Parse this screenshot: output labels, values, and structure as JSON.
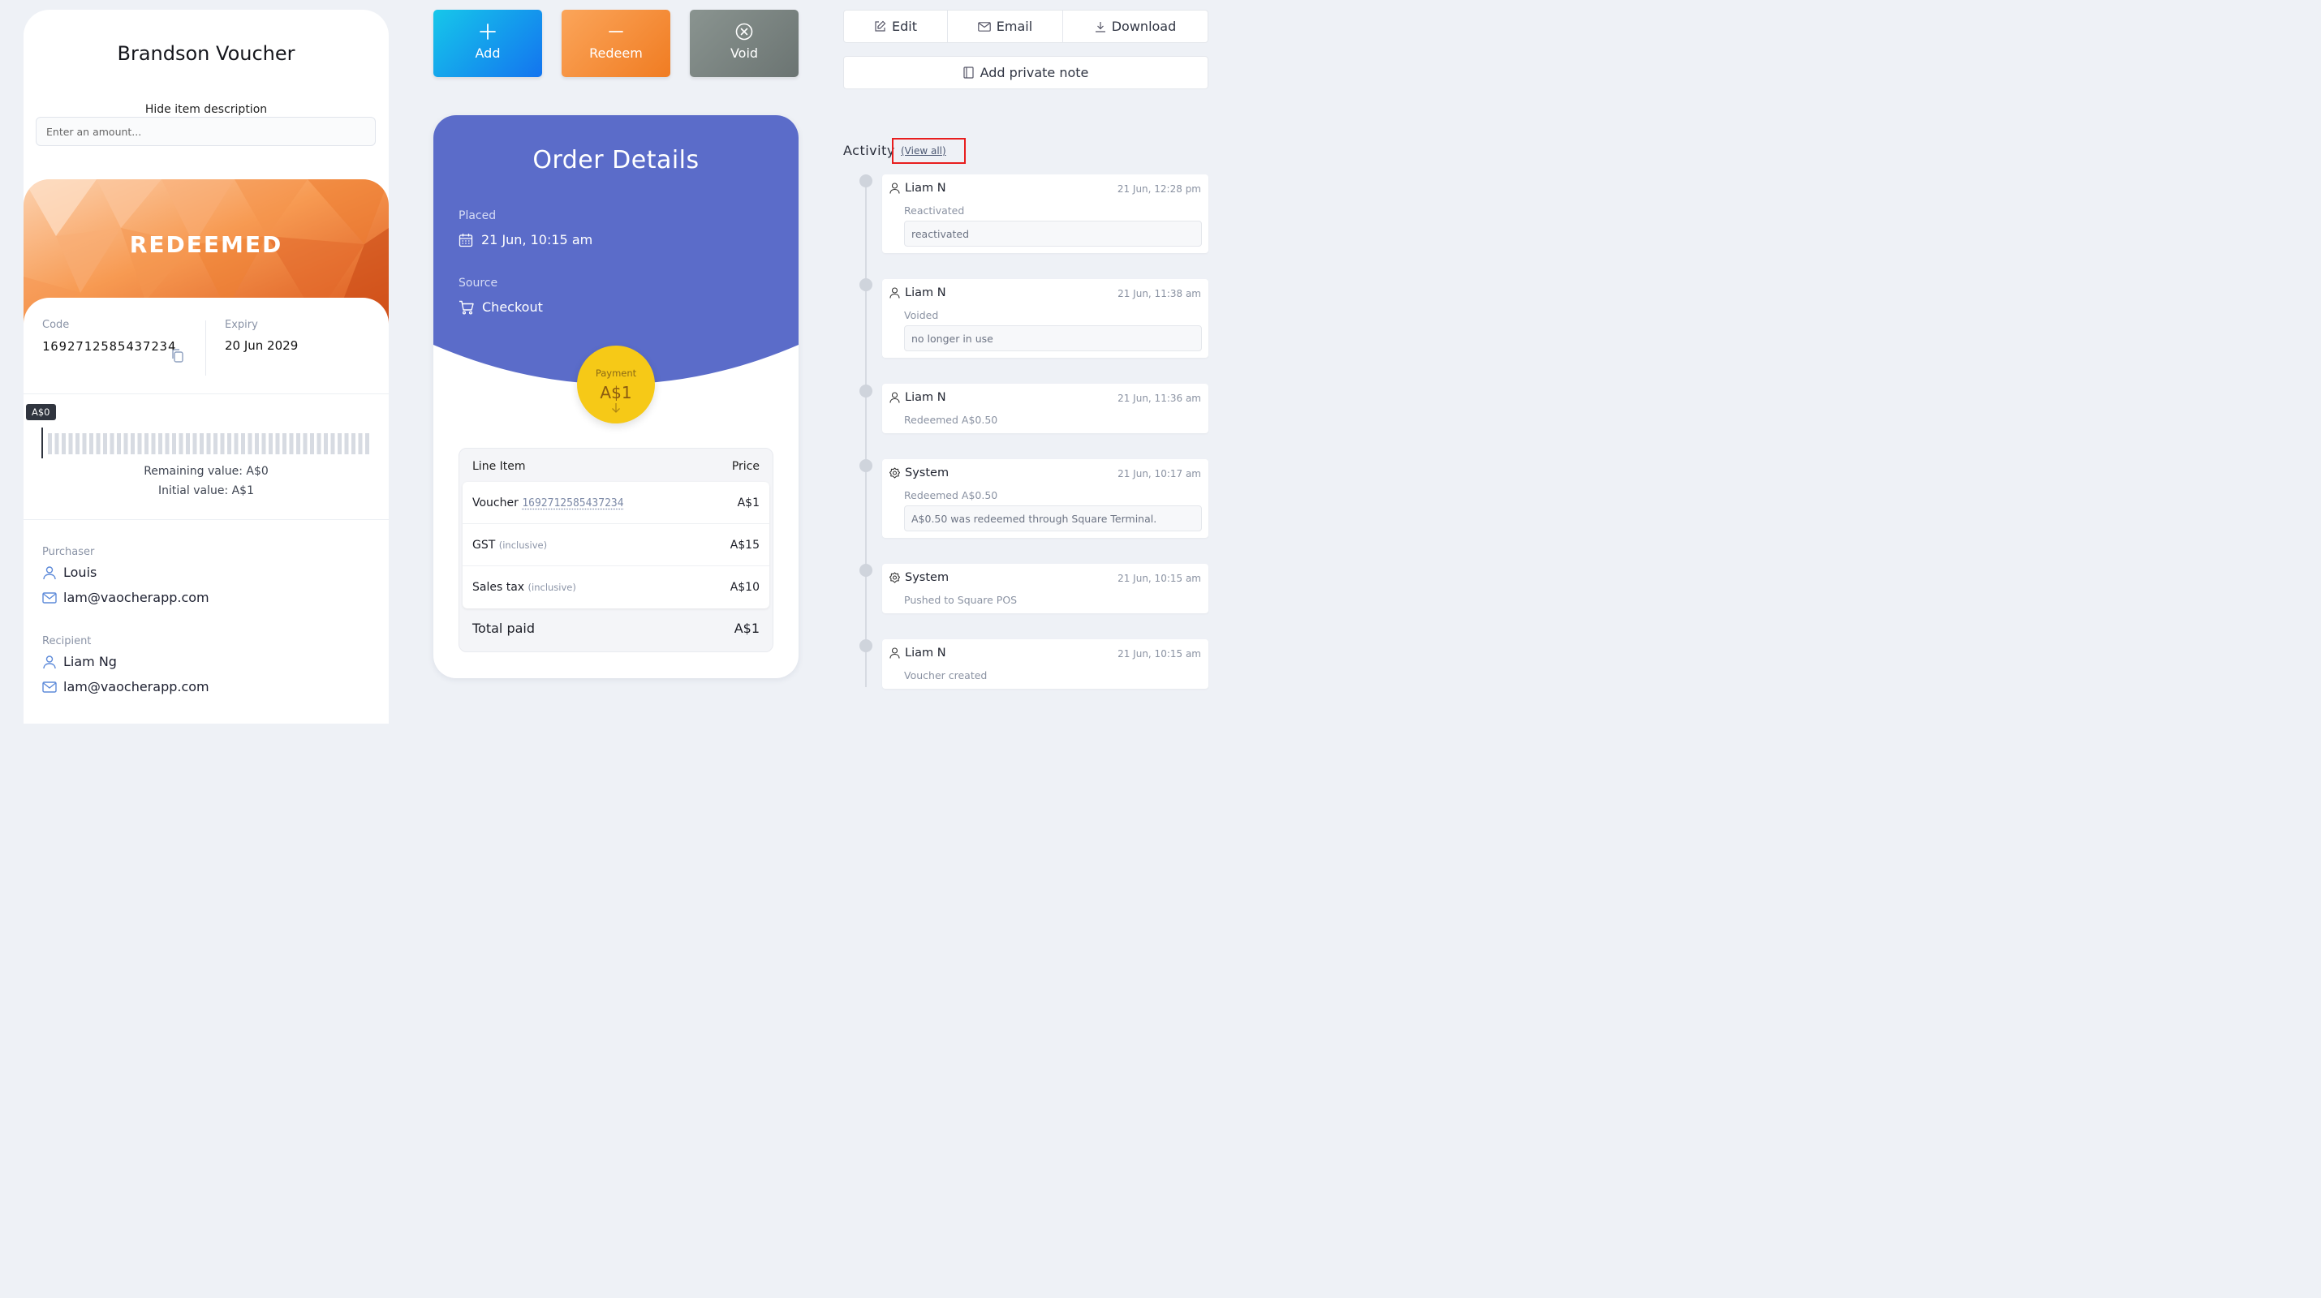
{
  "voucher": {
    "title": "Brandson Voucher",
    "hide_description": "Hide item description",
    "amount_placeholder": "Enter an amount...",
    "status": "REDEEMED",
    "code_label": "Code",
    "code": "1692712585437234",
    "expiry_label": "Expiry",
    "expiry": "20 Jun 2029",
    "balance_tag": "A$0",
    "balance_fraction": 0,
    "remaining": "Remaining value: A$0",
    "initial": "Initial value: A$1",
    "purchaser_label": "Purchaser",
    "purchaser_name": "Louis",
    "purchaser_email": "lam@vaocherapp.com",
    "recipient_label": "Recipient",
    "recipient_name": "Liam Ng",
    "recipient_email": "lam@vaocherapp.com"
  },
  "actions": {
    "add": "Add",
    "redeem": "Redeem",
    "void": "Void"
  },
  "order": {
    "title": "Order Details",
    "placed_label": "Placed",
    "placed_value": "21 Jun, 10:15 am",
    "source_label": "Source",
    "source_value": "Checkout",
    "payment_label": "Payment",
    "payment_value": "A$1",
    "col_item": "Line Item",
    "col_price": "Price",
    "items": [
      {
        "name": "Voucher",
        "link": "1692712585437234",
        "suffix": "",
        "price": "A$1"
      },
      {
        "name": "GST",
        "link": "",
        "suffix": "(inclusive)",
        "price": "A$15"
      },
      {
        "name": "Sales tax",
        "link": "",
        "suffix": "(inclusive)",
        "price": "A$10"
      }
    ],
    "total_label": "Total paid",
    "total_value": "A$1"
  },
  "toolbar": {
    "edit": "Edit",
    "email": "Email",
    "download": "Download",
    "private_note": "Add private note"
  },
  "activity": {
    "title": "Activity",
    "view_all": "(View all)",
    "entries": [
      {
        "user": "Liam N",
        "type": "person",
        "time": "21 Jun, 12:28 pm",
        "desc": "Reactivated",
        "note": "reactivated"
      },
      {
        "user": "Liam N",
        "type": "person",
        "time": "21 Jun, 11:38 am",
        "desc": "Voided",
        "note": "no longer in use"
      },
      {
        "user": "Liam N",
        "type": "person",
        "time": "21 Jun, 11:36 am",
        "desc": "Redeemed A$0.50",
        "note": ""
      },
      {
        "user": "System",
        "type": "system",
        "time": "21 Jun, 10:17 am",
        "desc": "Redeemed A$0.50",
        "note": "A$0.50 was redeemed through Square Terminal."
      },
      {
        "user": "System",
        "type": "system",
        "time": "21 Jun, 10:15 am",
        "desc": "Pushed to Square POS",
        "note": ""
      },
      {
        "user": "Liam N",
        "type": "person",
        "time": "21 Jun, 10:15 am",
        "desc": "Voucher created",
        "note": ""
      }
    ]
  },
  "colors": {
    "order_header": "#5b6cc9",
    "payment_circle": "#f6c917",
    "highlight_box": "#e81e1e"
  }
}
